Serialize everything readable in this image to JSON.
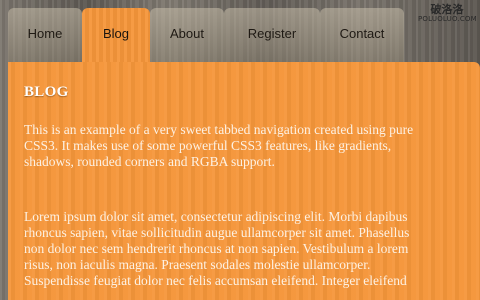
{
  "watermark": {
    "logo": "破洛洛",
    "site": "POLUOLUO.COM"
  },
  "nav": {
    "tabs": [
      {
        "label": "Home"
      },
      {
        "label": "Blog"
      },
      {
        "label": "About"
      },
      {
        "label": "Register"
      },
      {
        "label": "Contact"
      }
    ],
    "active": "Blog"
  },
  "content": {
    "heading": "BLOG",
    "paragraph1_lines": [
      "This is an example of a very sweet tabbed navigation created using pure",
      "CSS3. It makes use of some powerful CSS3 features, like gradients,",
      "shadows, rounded corners and RGBA support."
    ],
    "paragraph2_lines": [
      "Lorem ipsum dolor sit amet, consectetur adipiscing elit. Morbi dapibus",
      "rhoncus sapien, vitae sollicitudin augue ullamcorper sit amet. Phasellus",
      "non dolor nec sem hendrerit rhoncus at non sapien. Vestibulum a lorem",
      "risus, non iaculis magna. Praesent sodales molestie ullamcorper.",
      "Suspendisse feugiat dolor nec felis accumsan eleifend. Integer eleifend"
    ]
  },
  "colors": {
    "accent_orange": "#f5963a",
    "background_wood": "#6f6a63",
    "heading_text": "#ffffff",
    "body_text": "#fdf1e3"
  }
}
